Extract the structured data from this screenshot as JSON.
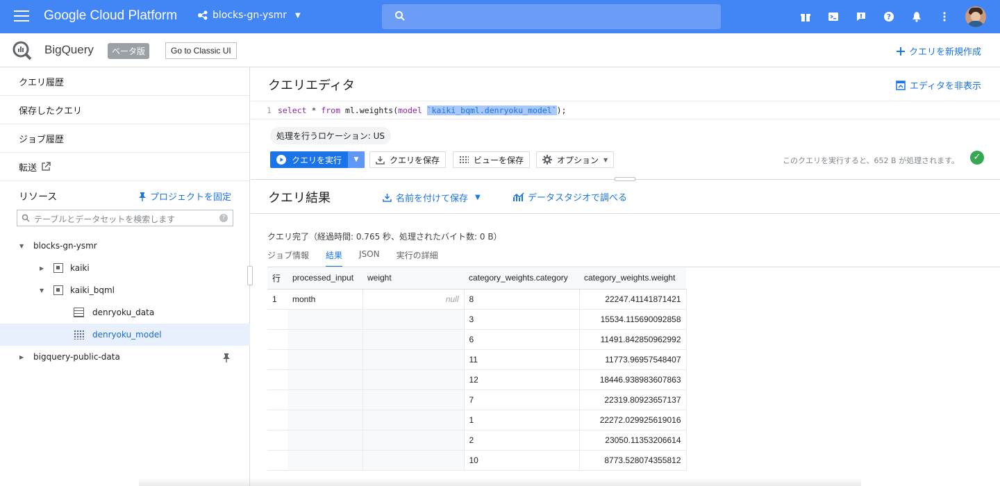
{
  "topbar": {
    "title": "Google Cloud Platform",
    "project": "blocks-gn-ysmr",
    "icons": [
      "gift-icon",
      "cloud-shell-icon",
      "feedback-icon",
      "help-icon",
      "notifications-icon",
      "more-vert-icon"
    ]
  },
  "subheader": {
    "product": "BigQuery",
    "beta": "ベータ版",
    "classic_button": "Go to Classic UI",
    "new_query": "クエリを新規作成"
  },
  "sidebar": {
    "nav": [
      "クエリ履歴",
      "保存したクエリ",
      "ジョブ履歴",
      "転送"
    ],
    "resources_label": "リソース",
    "pin_project": "プロジェクトを固定",
    "search_placeholder": "テーブルとデータセットを検索します",
    "tree": [
      {
        "label": "blocks-gn-ysmr"
      },
      {
        "label": "kaiki"
      },
      {
        "label": "kaiki_bqml"
      },
      {
        "label": "denryoku_data"
      },
      {
        "label": "denryoku_model"
      },
      {
        "label": "bigquery-public-data"
      }
    ]
  },
  "editor": {
    "title": "クエリエディタ",
    "hide_editor": "エディタを非表示",
    "line_number": "1",
    "code_kw1": "select",
    "code_mid1": " * ",
    "code_kw2": "from",
    "code_mid2": " ml.weights(",
    "code_kw3": "model",
    "code_space": " ",
    "code_highlight": "`kaiki_bqml.denryoku_model`",
    "code_end": ");",
    "location_chip": "処理を行うロケーション: US",
    "run_button": "クエリを実行",
    "save_query": "クエリを保存",
    "save_view": "ビューを保存",
    "options": "オプション",
    "process_note": "このクエリを実行すると、652 B が処理されます。"
  },
  "results": {
    "title": "クエリ結果",
    "save_as": "名前を付けて保存",
    "data_studio": "データスタジオで調べる",
    "complete": "クエリ完了（経過時間: 0.765 秒、処理されたバイト数: 0 B）",
    "tabs": [
      "ジョブ情報",
      "結果",
      "JSON",
      "実行の詳細"
    ],
    "columns": [
      "行",
      "processed_input",
      "weight",
      "category_weights.category",
      "category_weights.weight"
    ],
    "row_index": "1",
    "processed_input": "month",
    "weight": "null",
    "rows": [
      {
        "category": "8",
        "weight": "22247.41141871421"
      },
      {
        "category": "3",
        "weight": "15534.115690092858"
      },
      {
        "category": "6",
        "weight": "11491.842850962992"
      },
      {
        "category": "11",
        "weight": "11773.96957548407"
      },
      {
        "category": "12",
        "weight": "18446.938983607863"
      },
      {
        "category": "7",
        "weight": "22319.80923657137"
      },
      {
        "category": "1",
        "weight": "22272.029925619016"
      },
      {
        "category": "2",
        "weight": "23050.11353206614"
      },
      {
        "category": "10",
        "weight": "8773.528074355812"
      }
    ]
  }
}
